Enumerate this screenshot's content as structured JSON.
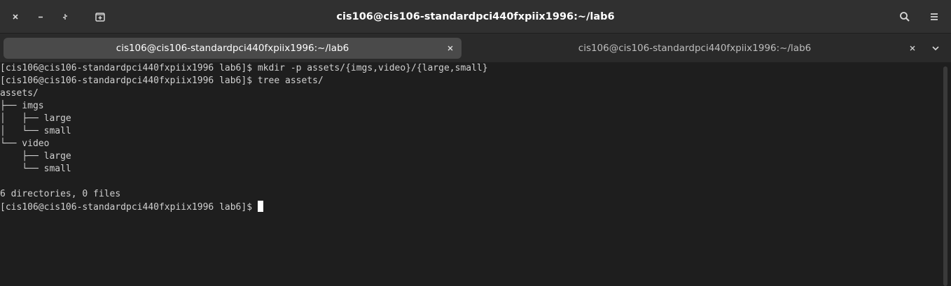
{
  "window": {
    "title": "cis106@cis106-standardpci440fxpiix1996:~/lab6"
  },
  "header": {
    "icons": [
      "close-icon",
      "minimize-icon",
      "restore-icon",
      "new-tab-icon",
      "search-icon",
      "menu-icon"
    ]
  },
  "tabs": [
    {
      "label": "cis106@cis106-standardpci440fxpiix1996:~/lab6",
      "active": true
    },
    {
      "label": "cis106@cis106-standardpci440fxpiix1996:~/lab6",
      "active": false
    }
  ],
  "terminal": {
    "lines": [
      "[cis106@cis106-standardpci440fxpiix1996 lab6]$ mkdir -p assets/{imgs,video}/{large,small}",
      "[cis106@cis106-standardpci440fxpiix1996 lab6]$ tree assets/",
      "assets/",
      "├── imgs",
      "│   ├── large",
      "│   └── small",
      "└── video",
      "    ├── large",
      "    └── small",
      "",
      "6 directories, 0 files"
    ],
    "prompt": "[cis106@cis106-standardpci440fxpiix1996 lab6]$ "
  },
  "colors": {
    "headerbar": "#303030",
    "tabbar": "#2a2a2a",
    "active_tab": "#4a4a4a",
    "terminal_bg": "#1e1e1e",
    "terminal_fg": "#d0d0d0"
  }
}
